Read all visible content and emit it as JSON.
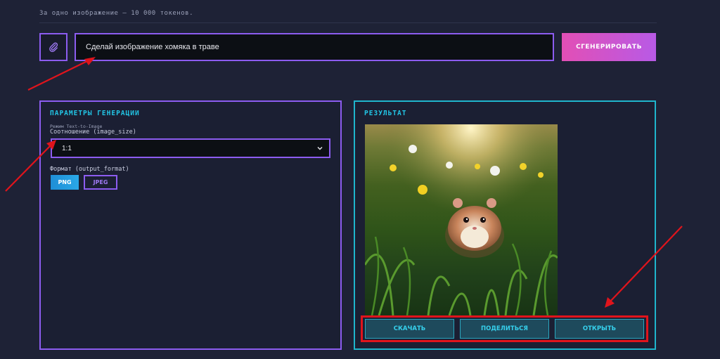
{
  "header": {
    "token_note": "За одно изображение — 10 000 токенов."
  },
  "prompt": {
    "value": "Сделай изображение хомяка в траве",
    "generate_label": "СГЕНЕРИРОВАТЬ",
    "attach_icon": "paperclip-icon"
  },
  "params": {
    "title": "ПАРАМЕТРЫ ГЕНЕРАЦИИ",
    "mode_label": "Режим Text-to-Image",
    "ratio_label": "Соотношение (image_size)",
    "ratio_value": "1:1",
    "format_label": "Формат (output_format)",
    "formats": [
      "PNG",
      "JPEG"
    ],
    "selected_format": "PNG"
  },
  "result": {
    "title": "РЕЗУЛЬТАТ",
    "actions": {
      "download": "СКАЧАТЬ",
      "share": "ПОДЕЛИТЬСЯ",
      "open": "ОТКРЫТЬ"
    }
  },
  "colors": {
    "background": "#1e2236",
    "accent_purple": "#8c5cf0",
    "accent_cyan": "#22c6e6",
    "annotation_red": "#e0141c"
  }
}
